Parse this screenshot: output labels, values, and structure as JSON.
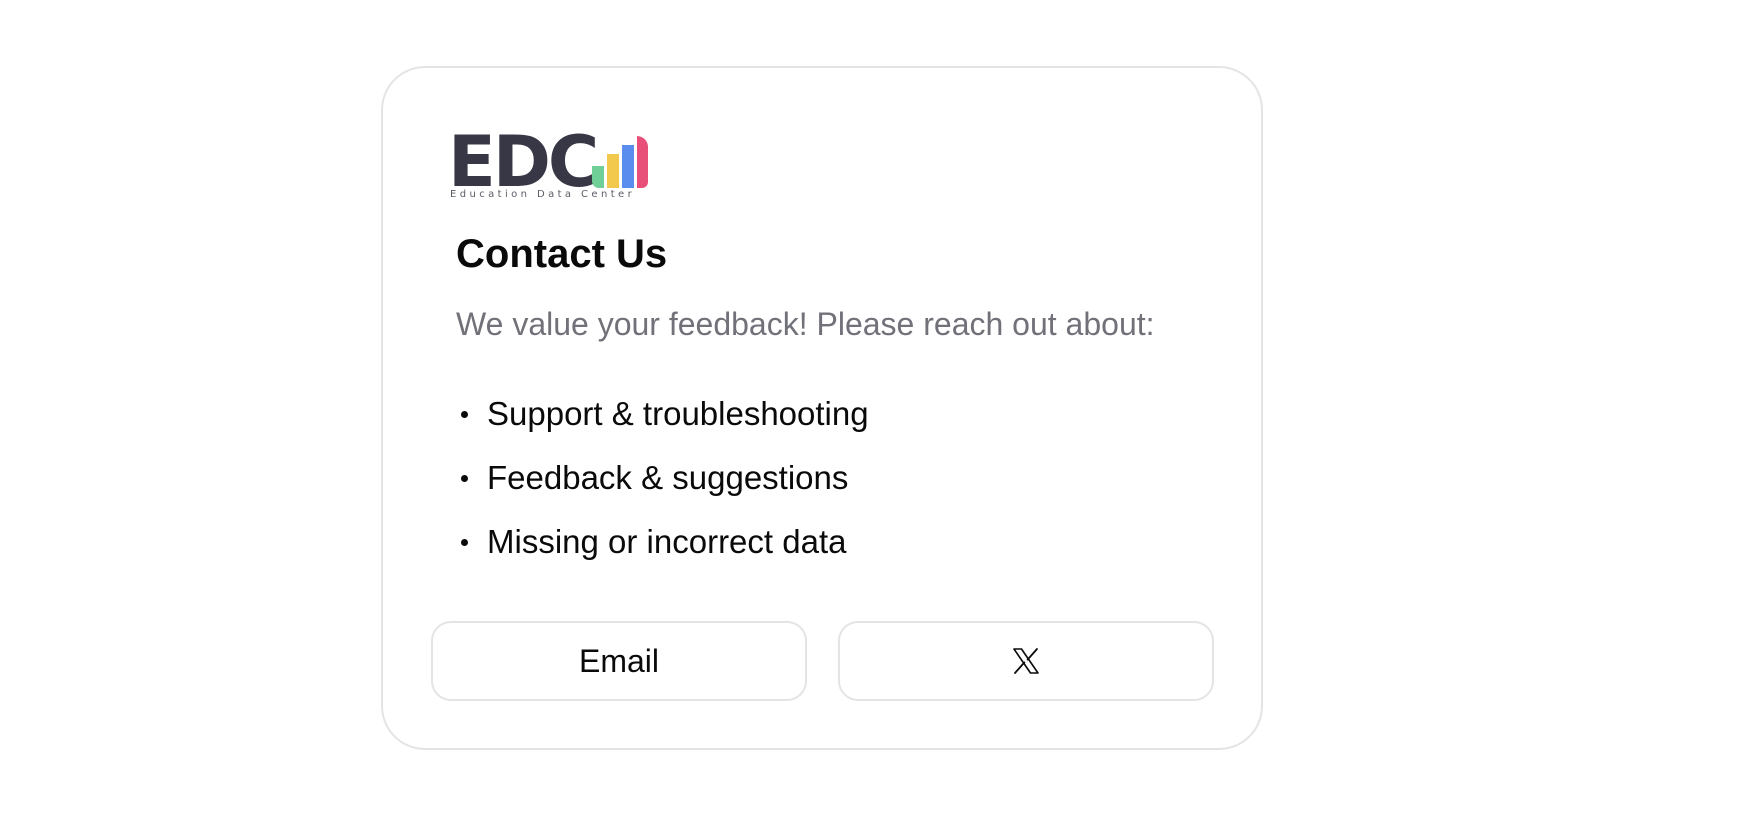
{
  "logo": {
    "wordmark": "EDC",
    "tagline": "Education Data Center",
    "colors": [
      "#6fcf97",
      "#f2c94c",
      "#5b8def",
      "#e8507a"
    ]
  },
  "contact": {
    "title": "Contact Us",
    "subtitle": "We value your feedback! Please reach out about:",
    "topics": [
      "Support & troubleshooting",
      "Feedback & suggestions",
      "Missing or incorrect data"
    ]
  },
  "buttons": {
    "email_label": "Email",
    "x_icon": "x-logo-icon"
  },
  "colors": {
    "border": "#e4e4e7",
    "text": "#0a0a0a",
    "muted": "#71717a",
    "logo_text": "#373745"
  }
}
